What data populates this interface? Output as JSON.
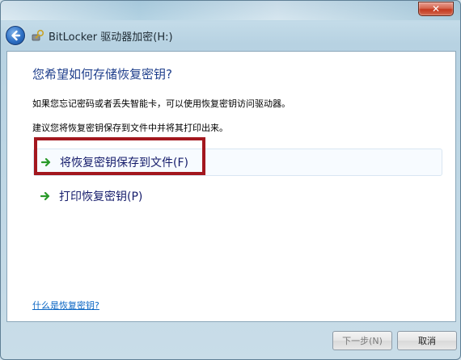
{
  "window": {
    "title": "BitLocker 驱动器加密(H:)",
    "close_label": "✕"
  },
  "content": {
    "heading": "您希望如何存储恢复密钥?",
    "para1": "如果您忘记密码或者丢失智能卡，可以使用恢复密钥访问驱动器。",
    "para2": "建议您将恢复密钥保存到文件中并将其打印出来。",
    "options": [
      {
        "label": "将恢复密钥保存到文件(F)"
      },
      {
        "label": "打印恢复密钥(P)"
      }
    ],
    "help_link": "什么是恢复密钥?"
  },
  "footer": {
    "next_label": "下一步(N)",
    "cancel_label": "取消"
  },
  "colors": {
    "heading": "#1f3f8c",
    "highlight": "#a3171e",
    "link": "#0b66c4",
    "arrow": "#2a9a2a"
  },
  "icons": {
    "back": "back-arrow-icon",
    "bitlocker": "bitlocker-key-icon",
    "option": "green-arrow-icon"
  }
}
